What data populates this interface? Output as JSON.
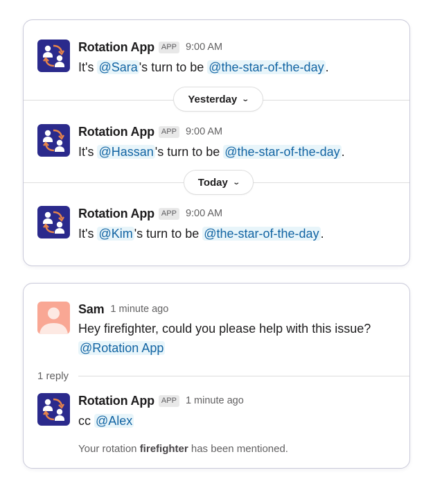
{
  "colors": {
    "app_avatar_bg": "#2b2a8c",
    "user_avatar_bg": "#f9a794",
    "mention_bg": "#e8f5fa",
    "mention_text": "#1264a3",
    "arrow_orange": "#e8854a"
  },
  "rotation_card": {
    "messages": [
      {
        "author": "Rotation App",
        "badge": "APP",
        "time": "9:00 AM",
        "prefix": "It's ",
        "mention_user": "@Sara",
        "middle": "'s turn to be ",
        "mention_group": "@the-star-of-the-day",
        "suffix": "."
      },
      {
        "author": "Rotation App",
        "badge": "APP",
        "time": "9:00 AM",
        "prefix": "It's ",
        "mention_user": "@Hassan",
        "middle": "'s turn to be ",
        "mention_group": "@the-star-of-the-day",
        "suffix": "."
      },
      {
        "author": "Rotation App",
        "badge": "APP",
        "time": "9:00 AM",
        "prefix": "It's ",
        "mention_user": "@Kim",
        "middle": "'s turn to be ",
        "mention_group": "@the-star-of-the-day",
        "suffix": "."
      }
    ],
    "date_dividers": [
      {
        "label": "Yesterday",
        "icon": "chevron-down-icon"
      },
      {
        "label": "Today",
        "icon": "chevron-down-icon"
      }
    ]
  },
  "thread_card": {
    "parent": {
      "author": "Sam",
      "time": "1 minute ago",
      "text": "Hey firefighter, could you please help with this issue?",
      "mention": "@Rotation App"
    },
    "reply_count": "1 reply",
    "reply": {
      "author": "Rotation App",
      "badge": "APP",
      "time": "1 minute ago",
      "prefix": "cc ",
      "mention": "@Alex"
    },
    "note": {
      "prefix": "Your rotation ",
      "bold": "firefighter",
      "suffix": " has been mentioned."
    }
  }
}
